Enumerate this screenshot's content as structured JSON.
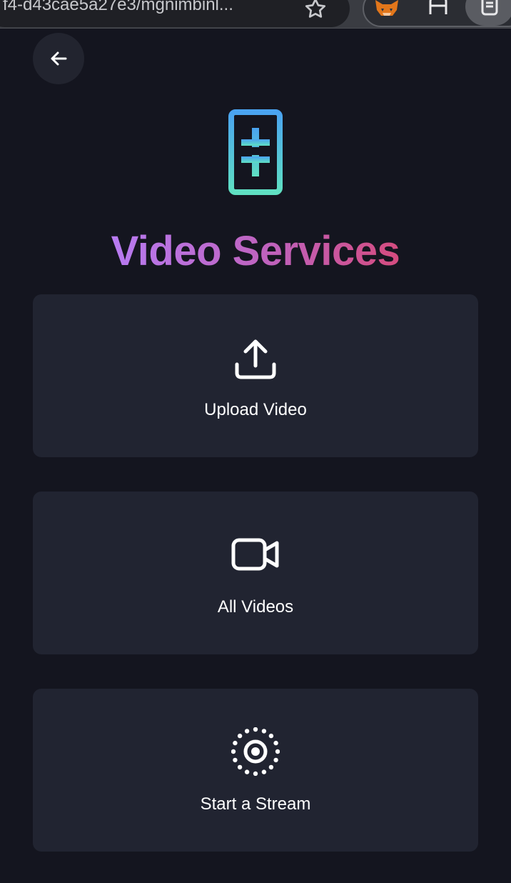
{
  "browser": {
    "url_text": "f4-d43cae5a27e3/mgnimbinl...",
    "extensions": [
      "fox-extension-icon",
      "reader-extension-icon",
      "document-extension-icon"
    ]
  },
  "header": {
    "back_icon": "arrow-left-icon"
  },
  "logo": {
    "name": "theta-logo"
  },
  "title": "Video Services",
  "title_gradient": [
    "#b77cf5",
    "#c060b8",
    "#d64a7a"
  ],
  "cards": [
    {
      "label": "Upload Video",
      "icon": "upload-icon"
    },
    {
      "label": "All Videos",
      "icon": "video-camera-icon"
    },
    {
      "label": "Start a Stream",
      "icon": "broadcast-icon"
    }
  ],
  "colors": {
    "background": "#14151f",
    "card": "#212431",
    "logo_gradient": [
      "#4aa3f0",
      "#5fe0c2"
    ]
  }
}
